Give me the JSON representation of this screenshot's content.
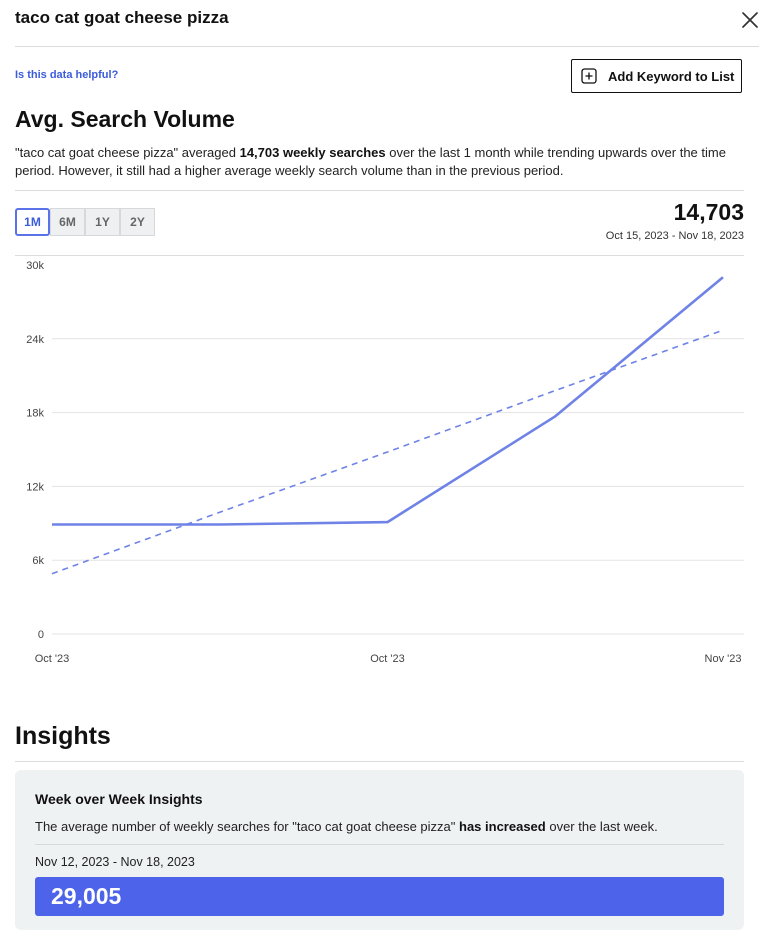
{
  "header": {
    "keyword": "taco cat goat cheese pizza"
  },
  "actions": {
    "helpful_link": "Is this data helpful?",
    "add_keyword_label": "Add Keyword to List"
  },
  "volume": {
    "title": "Avg. Search Volume",
    "summary_pre": "\"taco cat goat cheese pizza\" averaged ",
    "summary_bold": "14,703 weekly searches",
    "summary_post": " over the last 1 month while trending upwards over the time period. However, it still had a higher average weekly search volume than in the previous period.",
    "ranges": [
      "1M",
      "6M",
      "1Y",
      "2Y"
    ],
    "selected_range": "1M",
    "big_value": "14,703",
    "date_range": "Oct 15, 2023 - Nov 18, 2023"
  },
  "chart_data": {
    "type": "line",
    "title": "",
    "xlabel": "",
    "ylabel": "",
    "ylim": [
      0,
      30000
    ],
    "y_ticks": [
      "0",
      "6k",
      "12k",
      "18k",
      "24k",
      "30k"
    ],
    "y_tick_values": [
      0,
      6000,
      12000,
      18000,
      24000,
      30000
    ],
    "x_ticks": [
      "Oct '23",
      "Oct '23",
      "Nov '23"
    ],
    "x_tick_index": [
      0,
      2,
      4
    ],
    "grid": true,
    "series": [
      {
        "style": "solid",
        "color": "#6f82e6",
        "values": [
          8900,
          8900,
          9100,
          17700,
          29000
        ]
      },
      {
        "style": "dashed",
        "color": "#6f82e6",
        "values": [
          4900,
          9900,
          14800,
          19800,
          24700
        ]
      }
    ]
  },
  "insights": {
    "title": "Insights",
    "card_title": "Week over Week Insights",
    "text_pre": "The average number of weekly searches for \"taco cat goat cheese pizza\" ",
    "text_bold": "has increased",
    "text_post": " over the last week.",
    "date": "Nov 12, 2023 - Nov 18, 2023",
    "value": "29,005"
  }
}
